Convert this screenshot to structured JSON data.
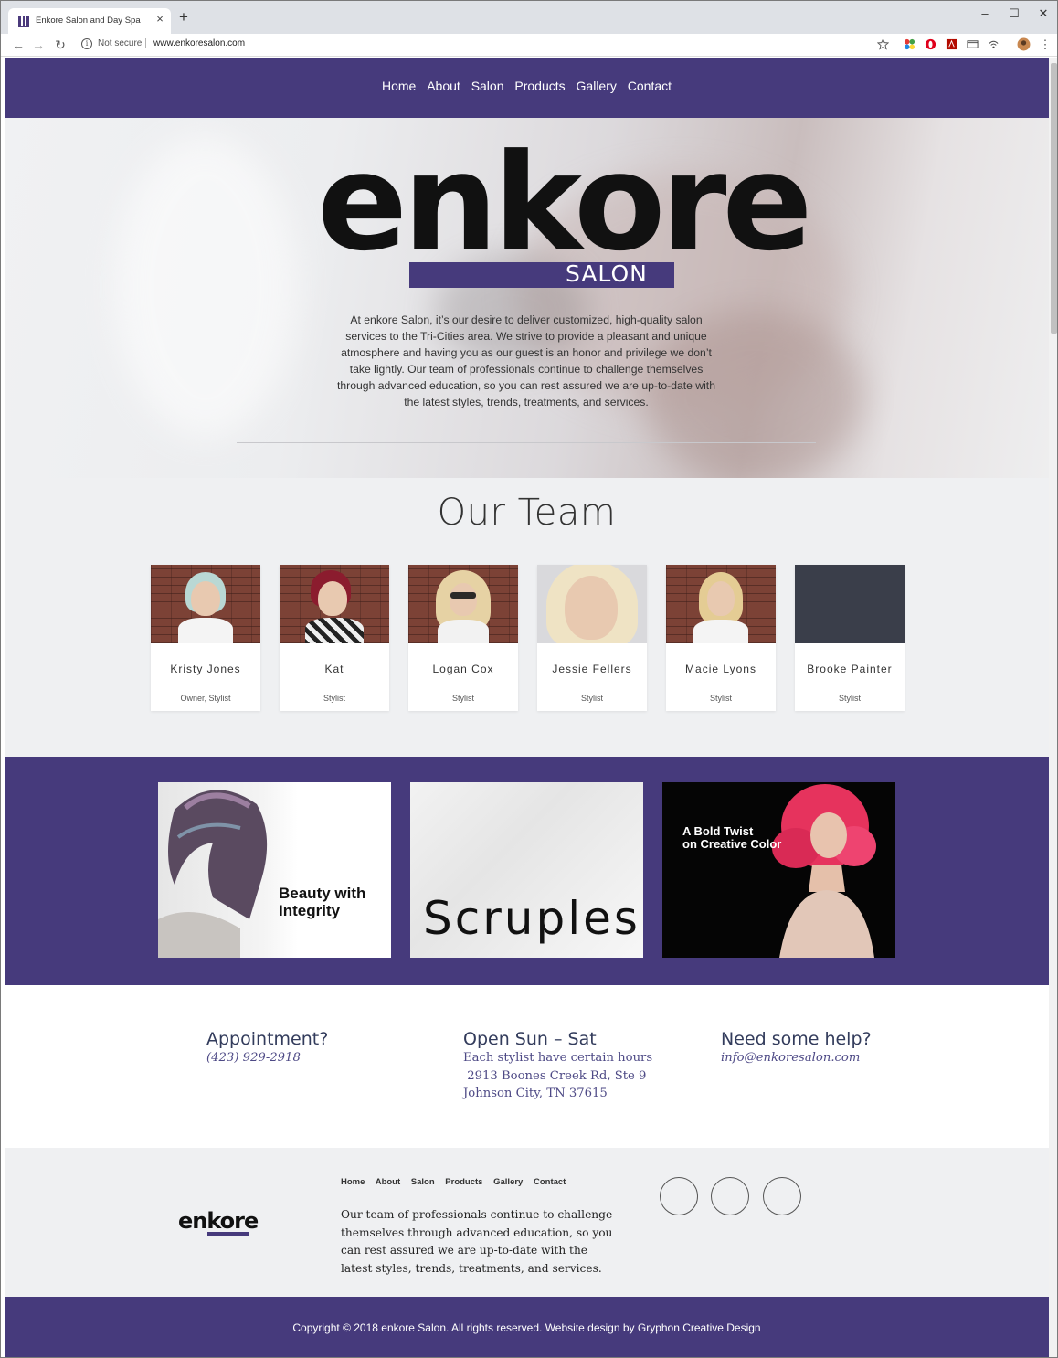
{
  "browser": {
    "tab_title": "Enkore Salon and Day Spa",
    "tab_close": "×",
    "new_tab": "+",
    "window_controls": {
      "minimize": "–",
      "maximize": "☐",
      "close": "✕"
    },
    "security": "Not secure",
    "url": "www.enkoresalon.com",
    "nav_icons": [
      "back-icon",
      "forward-icon",
      "reload-icon"
    ]
  },
  "site": {
    "nav": [
      "Home",
      "About",
      "Salon",
      "Products",
      "Gallery",
      "Contact"
    ],
    "brand_color": "#463a7c",
    "hero": {
      "logo_word": "enkore",
      "logo_sub": "SALON",
      "text": "At enkore Salon, it’s our desire to deliver customized, high-quality salon services to the Tri-Cities area. We strive to provide a pleasant and unique atmosphere and having you as our guest is an honor and privilege we don’t take lightly. Our team of professionals continue to challenge themselves through advanced education, so you can rest assured we are up-to-date with the latest styles, trends, treatments, and services."
    },
    "team": {
      "title": "Our Team",
      "members": [
        {
          "name": "Kristy Jones",
          "role": "Owner, Stylist"
        },
        {
          "name": "Kat",
          "role": "Stylist"
        },
        {
          "name": "Logan Cox",
          "role": "Stylist"
        },
        {
          "name": "Jessie Fellers",
          "role": "Stylist"
        },
        {
          "name": "Macie Lyons",
          "role": "Stylist"
        },
        {
          "name": "Brooke Painter",
          "role": "Stylist"
        }
      ]
    },
    "brands": {
      "beauty_line1": "Beauty with",
      "beauty_line2": "Integrity",
      "scruples": "Scruples",
      "scruples_mark": "®",
      "bold_line1": "A Bold Twist",
      "bold_line2": "on Creative Color"
    },
    "info": {
      "appointment": {
        "heading": "Appointment?",
        "phone": "(423) 929-2918"
      },
      "hours": {
        "heading": "Open Sun – Sat",
        "line1": "Each stylist have certain hours",
        "line2": " 2913 Boones Creek Rd, Ste 9",
        "line3": "Johnson City, TN 37615"
      },
      "help": {
        "heading": "Need some help?",
        "email": "info@enkoresalon.com"
      }
    },
    "footer": {
      "logo": "enkore",
      "nav": [
        "Home",
        "About",
        "Salon",
        "Products",
        "Gallery",
        "Contact"
      ],
      "text": "Our team of professionals continue to challenge themselves through advanced education, so you can rest assured we are up-to-date with the latest styles, trends, treatments, and services.",
      "social_icons": [
        "facebook-icon",
        "instagram-icon",
        "twitter-icon"
      ],
      "copyright": "Copyright © 2018 enkore Salon. All rights reserved. Website design by Gryphon Creative Design"
    }
  }
}
